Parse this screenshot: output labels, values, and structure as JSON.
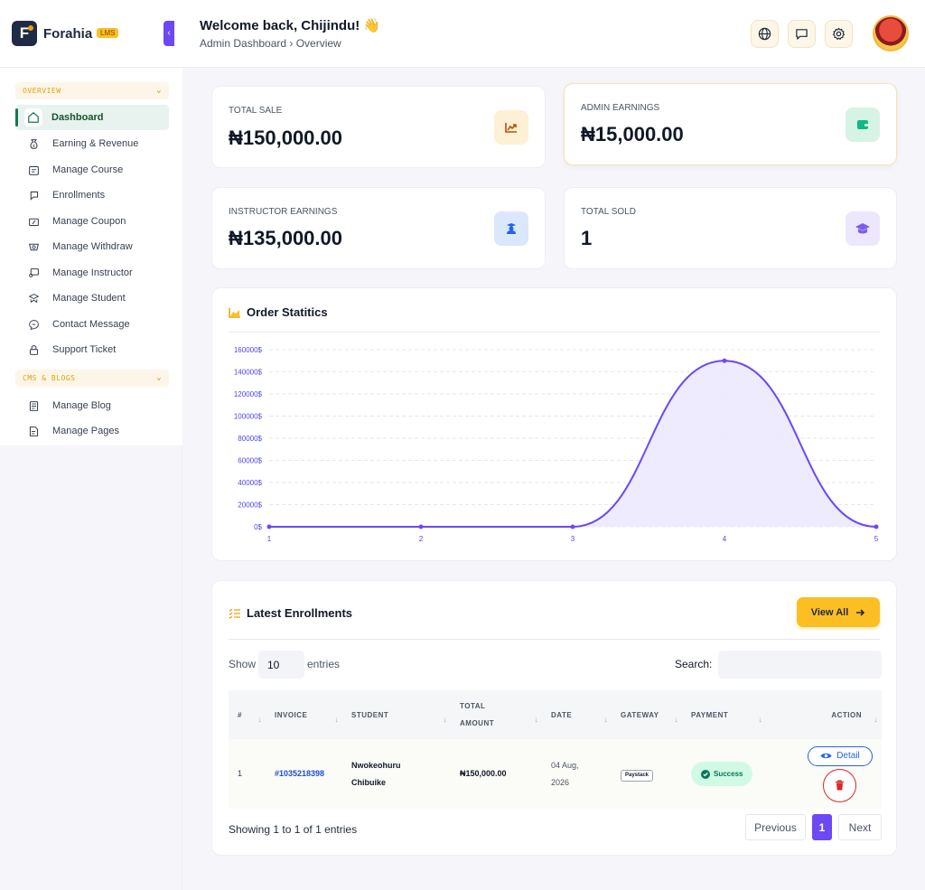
{
  "brand": {
    "name": "Forahia",
    "badge": "LMS",
    "logo_letter": "F",
    "collapse_glyph": "‹"
  },
  "header": {
    "welcome": "Welcome back, Chijindu! 👋",
    "breadcrumb": "Admin Dashboard › Overview",
    "icons": [
      "globe-icon",
      "message-icon",
      "settings-icon"
    ]
  },
  "sidebar": {
    "sections": [
      {
        "label": "OVERVIEW",
        "items": [
          {
            "label": "Dashboard",
            "icon": "home-icon",
            "active": true
          },
          {
            "label": "Earning & Revenue",
            "icon": "money-bag-icon"
          },
          {
            "label": "Manage Course",
            "icon": "course-icon"
          },
          {
            "label": "Enrollments",
            "icon": "enroll-icon"
          },
          {
            "label": "Manage Coupon",
            "icon": "coupon-icon"
          },
          {
            "label": "Manage Withdraw",
            "icon": "withdraw-icon"
          },
          {
            "label": "Manage Instructor",
            "icon": "instructor-icon"
          },
          {
            "label": "Manage Student",
            "icon": "student-icon"
          },
          {
            "label": "Contact Message",
            "icon": "chat-icon"
          },
          {
            "label": "Support Ticket",
            "icon": "lock-icon"
          }
        ]
      },
      {
        "label": "CMS & BLOGS",
        "items": [
          {
            "label": "Manage Blog",
            "icon": "blog-icon"
          },
          {
            "label": "Manage Pages",
            "icon": "pages-icon"
          }
        ]
      }
    ]
  },
  "stats": {
    "total_sale": {
      "label": "TOTAL SALE",
      "value": "₦150,000.00"
    },
    "admin_earnings": {
      "label": "ADMIN EARNINGS",
      "value": "₦15,000.00"
    },
    "instructor_earnings": {
      "label": "INSTRUCTOR EARNINGS",
      "value": "₦135,000.00"
    },
    "total_sold": {
      "label": "TOTAL SOLD",
      "value": "1"
    }
  },
  "colors": {
    "accent": "#6d48f5",
    "brand_dark": "#1f2a44",
    "warning": "#fbbf24",
    "success": "#047857",
    "danger": "#dc2626",
    "link": "#1d4ed8"
  },
  "order_stats": {
    "title": "Order Statitics",
    "chart_data": {
      "type": "area",
      "x": [
        1,
        2,
        3,
        4,
        5
      ],
      "values": [
        0,
        0,
        0,
        150000,
        0
      ],
      "ylim": [
        0,
        160000
      ],
      "yticks": [
        "0$",
        "20000$",
        "40000$",
        "60000$",
        "80000$",
        "100000$",
        "120000$",
        "140000$",
        "160000$"
      ],
      "xticks": [
        "1",
        "2",
        "3",
        "4",
        "5"
      ],
      "grid": true,
      "line_color": "#6d48f5",
      "fill_color": "#ede9fe"
    }
  },
  "enrollments": {
    "title": "Latest Enrollments",
    "view_all": "View All",
    "show_label": "Show",
    "page_size": "10",
    "entries_label": "entries",
    "search_label": "Search:",
    "columns": [
      "#",
      "INVOICE",
      "STUDENT",
      "TOTAL AMOUNT",
      "DATE",
      "GATEWAY",
      "PAYMENT",
      "ACTION"
    ],
    "rows": [
      {
        "num": "1",
        "invoice": "#1035218398",
        "student": "Nwokeohuru Chibuike",
        "amount": "₦150,000.00",
        "date": "04 Aug, 2026",
        "gateway": "Paystack",
        "payment": "Success",
        "detail_label": "Detail"
      }
    ],
    "showing": "Showing 1 to 1 of 1 entries",
    "pagination": {
      "previous": "Previous",
      "current": "1",
      "next": "Next"
    }
  }
}
